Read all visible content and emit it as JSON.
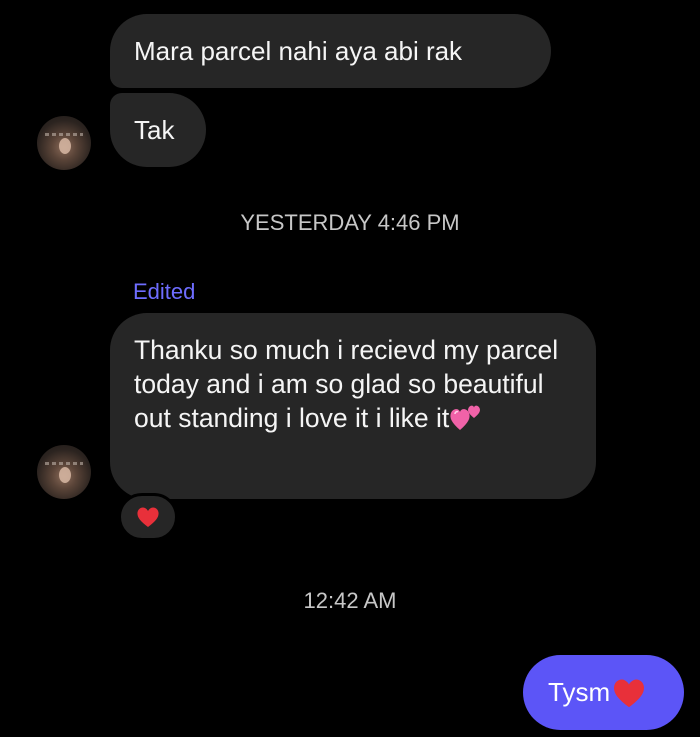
{
  "messages": {
    "incoming_1": "Mara parcel nahi aya abi rak",
    "incoming_2": "Tak",
    "incoming_3_edited_label": "Edited",
    "incoming_3": "Thanku so much i recievd my parcel today and i am so glad so beautiful out standing i love it i like it",
    "incoming_3_emoji": "two-hearts-icon",
    "incoming_3_reaction": "red-heart-icon",
    "outgoing_1": "Tysm",
    "outgoing_1_emoji": "red-heart-icon"
  },
  "timestamps": {
    "first": "YESTERDAY 4:46 PM",
    "second": "12:42 AM"
  },
  "colors": {
    "background": "#000000",
    "incoming_bubble": "#262626",
    "outgoing_bubble": "#5c55f7",
    "edited_label": "#6e6dff",
    "heart": "#e8303a"
  }
}
